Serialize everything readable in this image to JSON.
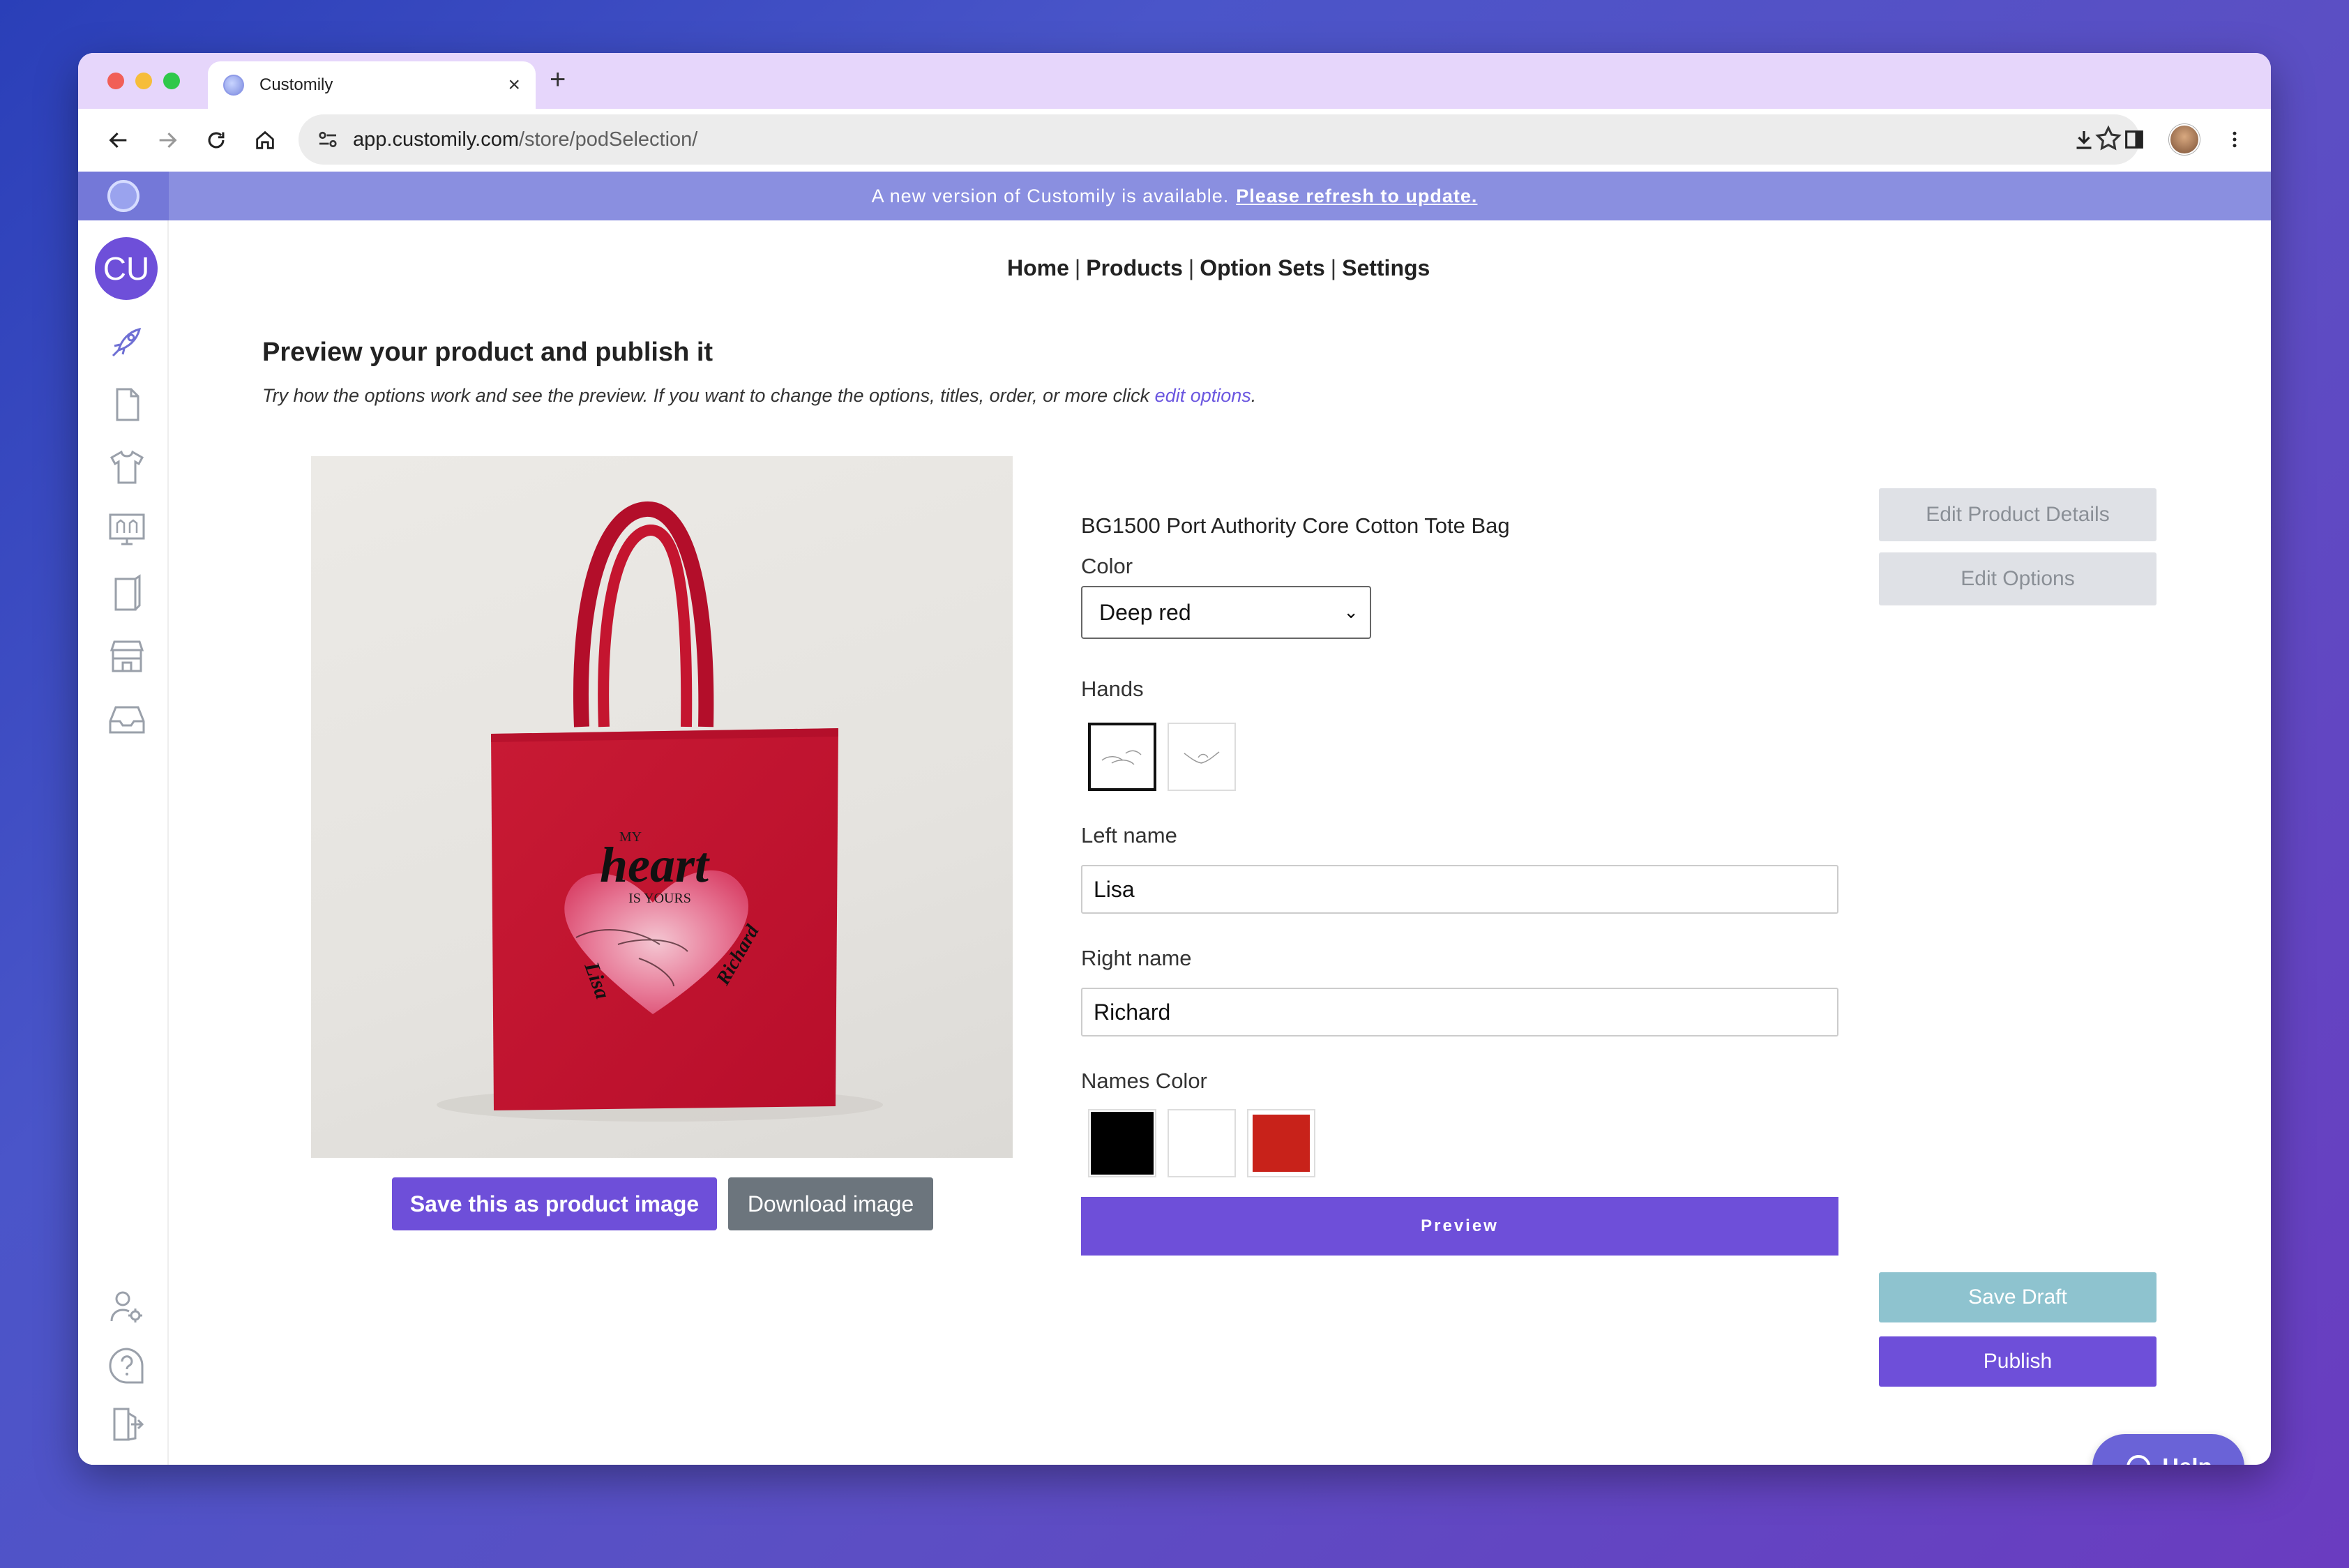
{
  "browser": {
    "tab_title": "Customily",
    "tab_close": "×",
    "new_tab": "+",
    "url_host": "app.customily.com",
    "url_path": "/store/podSelection/"
  },
  "banner": {
    "text": "A new version of Customily is available.",
    "link": "Please refresh to update."
  },
  "sidebar": {
    "avatar_initials": "CU",
    "items": [
      "rocket-icon",
      "page-icon",
      "tshirt-icon",
      "monitor-icon",
      "book-icon",
      "store-icon",
      "inbox-icon"
    ],
    "bottom_items": [
      "user-settings-icon",
      "help-icon",
      "logout-icon"
    ]
  },
  "nav": {
    "home": "Home",
    "products": "Products",
    "option_sets": "Option Sets",
    "settings": "Settings",
    "separator": "|"
  },
  "page": {
    "title": "Preview your product and publish it",
    "subtitle": "Try how the options work and see the preview. If you want to change the options, titles, order, or more click",
    "subtitle_link": "edit options",
    "subtitle_end": "."
  },
  "preview_image": {
    "text_my": "MY",
    "text_heart": "heart",
    "text_is_yours": "IS YOURS",
    "text_left_name": "Lisa",
    "text_right_name": "Richard"
  },
  "image_actions": {
    "save_product_image": "Save this as product image",
    "download_image": "Download image"
  },
  "form": {
    "product_name": "BG1500 Port Authority Core Cotton Tote Bag",
    "color_label": "Color",
    "color_value": "Deep red",
    "hands_label": "Hands",
    "left_name_label": "Left name",
    "left_name_value": "Lisa",
    "right_name_label": "Right name",
    "right_name_value": "Richard",
    "names_color_label": "Names Color",
    "names_colors": [
      "#000000",
      "#ffffff",
      "#c8221a"
    ],
    "preview_button": "Preview"
  },
  "actions": {
    "edit_product_details": "Edit Product Details",
    "edit_options": "Edit Options",
    "save_draft": "Save Draft",
    "publish": "Publish",
    "help": "Help"
  },
  "colors": {
    "accent": "#6e4fd9",
    "banner": "#8a8fe0",
    "tote": "#c41230"
  }
}
